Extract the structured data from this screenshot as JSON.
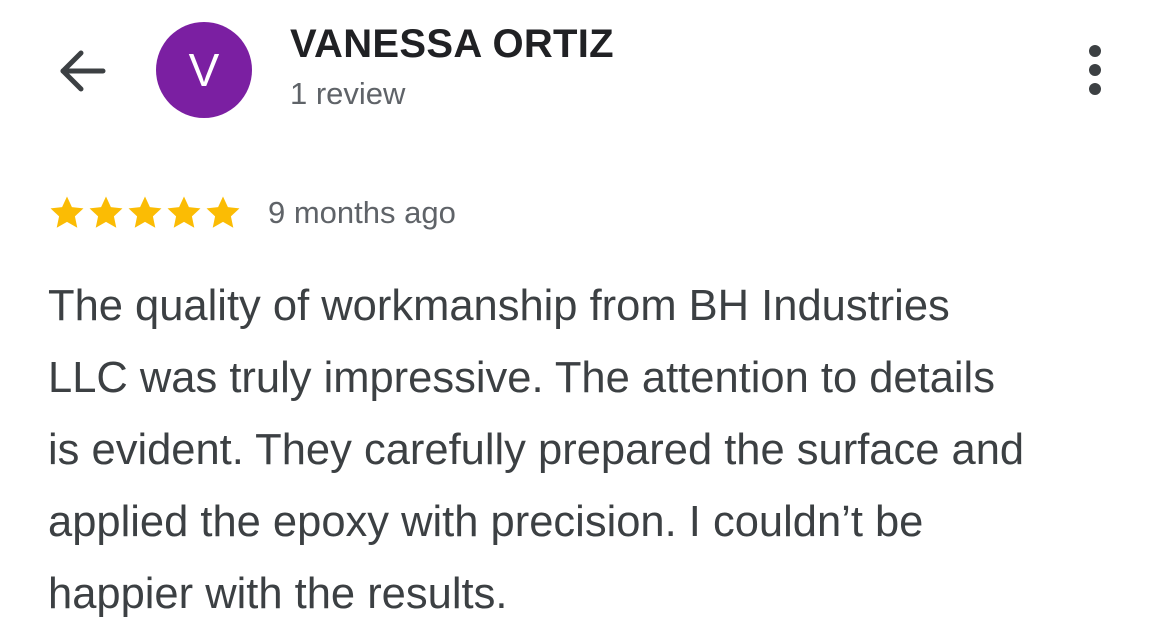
{
  "header": {
    "back_icon": "arrow-left-icon",
    "avatar": {
      "letter": "V",
      "color": "#7b1fa2"
    },
    "reviewer_name": "VANESSA ORTIZ",
    "review_count": "1 review",
    "more_icon": "more-vertical-icon"
  },
  "review": {
    "rating": 5,
    "max_rating": 5,
    "star_color": "#fbbc04",
    "time_ago": "9 months ago",
    "text_lines": [
      "The quality of workmanship from BH Industries",
      "LLC was truly impressive. The attention to details",
      "is evident. They carefully prepared the surface and",
      "applied the epoxy with precision. I couldn’t be",
      "happier with the results."
    ]
  }
}
